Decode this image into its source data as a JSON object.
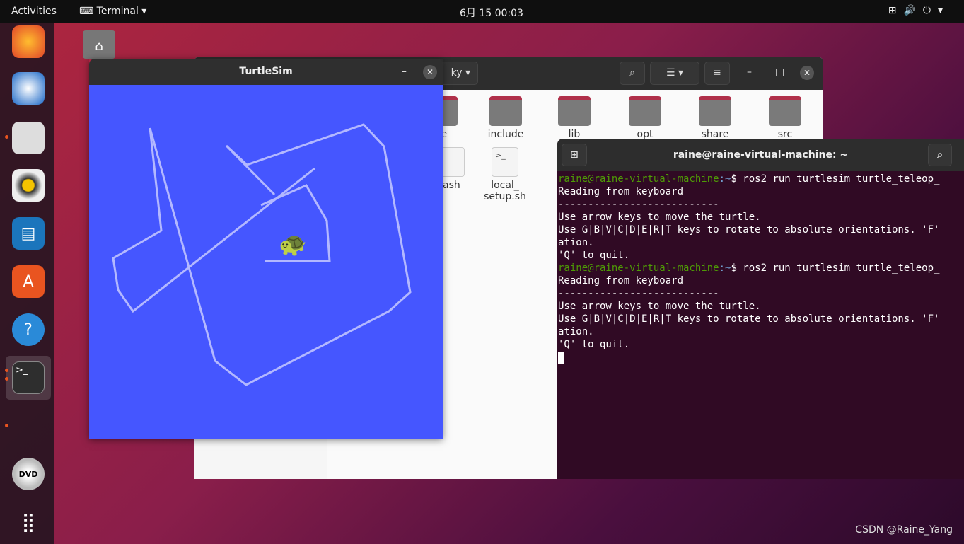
{
  "topbar": {
    "activities": "Activities",
    "app": "Terminal",
    "clock": "6月 15  00:03",
    "tray_icons": [
      "network-icon",
      "volume-icon",
      "power-icon"
    ]
  },
  "dock": {
    "items": [
      "firefox",
      "thunderbird",
      "files",
      "rhythmbox",
      "libreoffice-writer",
      "software",
      "help",
      "terminal",
      "dvd",
      "show-apps"
    ]
  },
  "files": {
    "location_partial": "ky",
    "folders": [
      {
        "label": "ke"
      },
      {
        "label": "include"
      },
      {
        "label": "lib"
      },
      {
        "label": "opt"
      },
      {
        "label": "share"
      },
      {
        "label": "src"
      }
    ],
    "files": [
      {
        "label": "bash"
      },
      {
        "label": "local_\nsetup.sh"
      }
    ]
  },
  "turtlesim": {
    "title": "TurtleSim",
    "background": "#4556ff",
    "pen_color": "#b3b8ff"
  },
  "terminal": {
    "title": "raine@raine-virtual-machine: ~",
    "prompt_user": "raine@raine-virtual-machine",
    "prompt_path": ":~",
    "command": "$ ros2 run turtlesim turtle_teleop_",
    "output": [
      "Reading from keyboard",
      "---------------------------",
      "Use arrow keys to move the turtle.",
      "Use G|B|V|C|D|E|R|T keys to rotate to absolute orientations. 'F'",
      "ation.",
      "'Q' to quit."
    ]
  },
  "watermark": "CSDN @Raine_Yang"
}
